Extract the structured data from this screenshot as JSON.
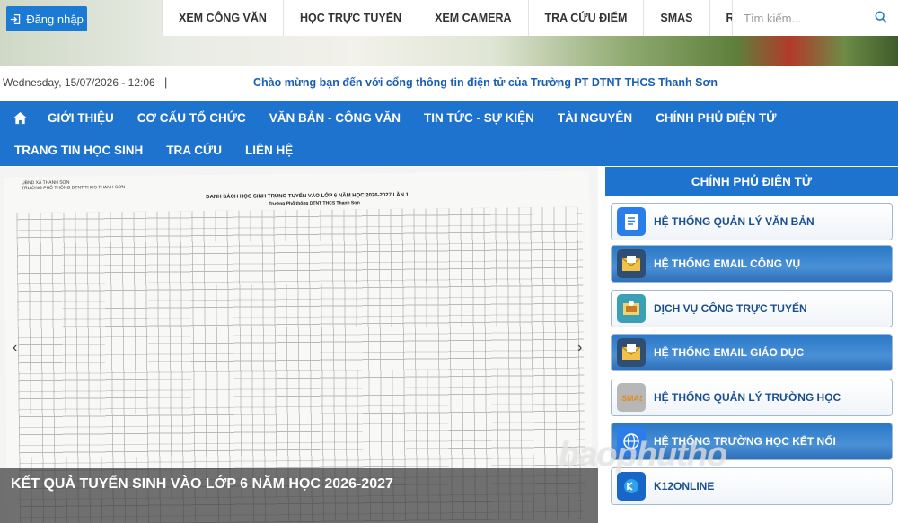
{
  "topbar": {
    "login_label": "Đăng nhập",
    "nav": [
      "XEM CÔNG VĂN",
      "HỌC TRỰC TUYẾN",
      "XEM CAMERA",
      "TRA CỨU ĐIỂM",
      "SMAS",
      "RSS"
    ],
    "search_placeholder": "Tìm kiếm..."
  },
  "info": {
    "date": "Wednesday, 15/07/2026 - 12:06",
    "separator": "|",
    "marquee": "Chào mừng bạn đến với cổng thông tin điện tử của Trường PT DTNT THCS Thanh Sơn"
  },
  "mainnav": {
    "row1": [
      "GIỚI THIỆU",
      "CƠ CẤU TỔ CHỨC",
      "VĂN BẢN - CÔNG VĂN",
      "TIN TỨC - SỰ KIỆN",
      "TÀI NGUYÊN",
      "CHÍNH PHỦ ĐIỆN TỬ"
    ],
    "row2": [
      "TRANG TIN HỌC SINH",
      "TRA CỨU",
      "LIÊN HỆ"
    ]
  },
  "slider": {
    "doc_header": "UBND XÃ THANH SƠN\nTRƯỜNG PHỔ THÔNG DTNT THCS THANH SƠN",
    "doc_title": "DANH SÁCH HỌC SINH TRÚNG TUYỂN VÀO LỚP 6 NĂM HỌC 2026-2027 LẦN 1",
    "doc_subtitle": "Trường Phổ thông DTNT THCS Thanh Sơn",
    "caption": "KẾT QUẢ TUYỂN SINH VÀO LỚP 6 NĂM HỌC 2026-2027"
  },
  "sidebar": {
    "title": "CHÍNH PHỦ ĐIỆN TỬ",
    "items": [
      {
        "label": "HỆ THỐNG QUẢN LÝ VĂN BẢN",
        "style": "light",
        "icon": "document-icon",
        "color": "#2b7de9"
      },
      {
        "label": "HỆ THỐNG EMAIL CÔNG VỤ",
        "style": "dark",
        "icon": "envelope-icon",
        "color": "#f0c14b"
      },
      {
        "label": "DỊCH VỤ CÔNG TRỰC TUYẾN",
        "style": "light",
        "icon": "public-service-icon",
        "color": "#3aa0b8"
      },
      {
        "label": "HỆ THỐNG EMAIL GIÁO DỤC",
        "style": "dark",
        "icon": "envelope-icon",
        "color": "#f0c14b"
      },
      {
        "label": "HỆ THỐNG QUẢN LÝ TRƯỜNG HỌC",
        "style": "light",
        "icon": "smas-icon",
        "color": "#8a8a8a"
      },
      {
        "label": "HỆ THỐNG TRƯỜNG HỌC KẾT NỐI",
        "style": "dark",
        "icon": "globe-icon",
        "color": "#2b7de9"
      },
      {
        "label": "K12ONLINE",
        "style": "light",
        "icon": "k12-icon",
        "color": "#1a66c8"
      }
    ]
  },
  "watermark": "baophutho"
}
